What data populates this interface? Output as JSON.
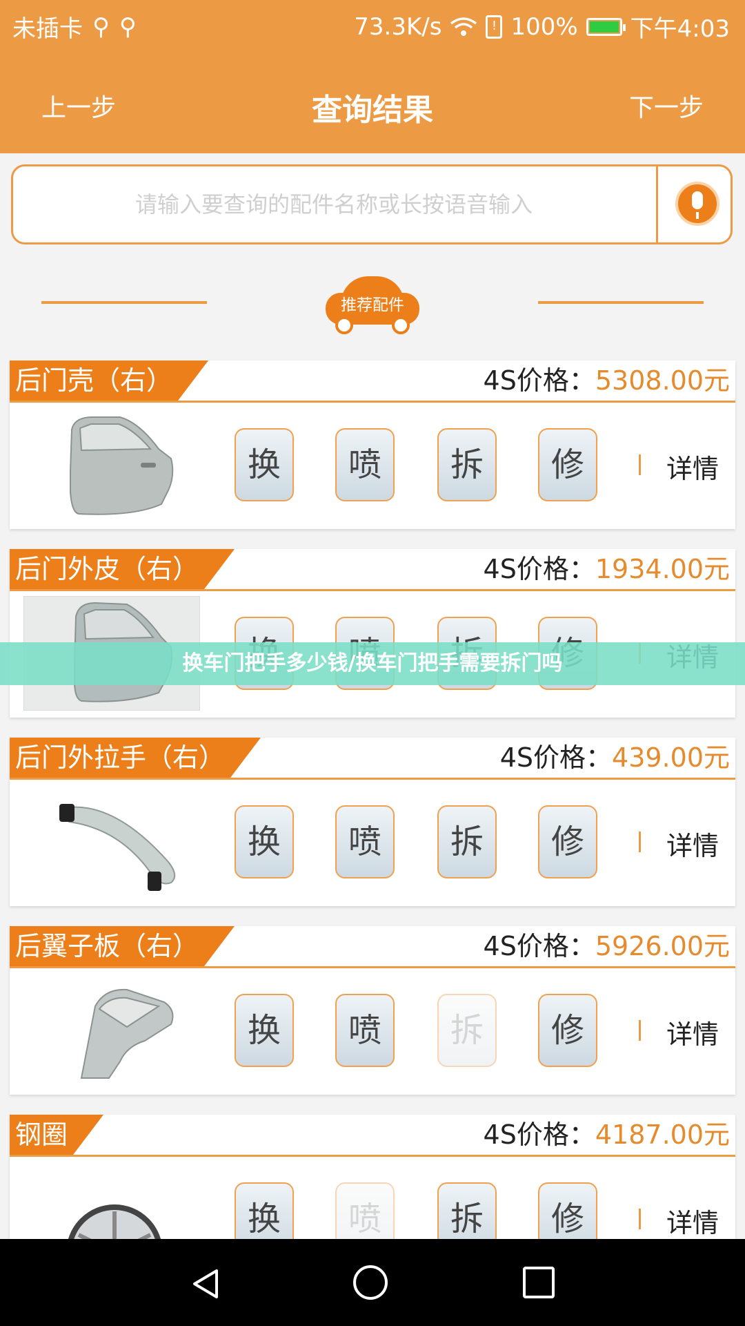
{
  "status_bar": {
    "carrier": "未插卡",
    "usb_icons": [
      "usb-icon",
      "usb-icon"
    ],
    "speed": "73.3K/s",
    "battery": "100%",
    "time": "下午4:03"
  },
  "header": {
    "prev_label": "上一步",
    "title": "查询结果",
    "next_label": "下一步"
  },
  "search": {
    "placeholder": "请输入要查询的配件名称或长按语音输入",
    "value": ""
  },
  "section": {
    "label": "推荐配件"
  },
  "parts": [
    {
      "name": "后门壳（右）",
      "price_label": "4S价格：",
      "price": "5308.00元",
      "image": "rear-door-shell-image",
      "actions": [
        "换",
        "喷",
        "拆",
        "修"
      ],
      "disabled": [
        false,
        false,
        false,
        false
      ],
      "detail": "详情"
    },
    {
      "name": "后门外皮（右）",
      "price_label": "4S价格：",
      "price": "1934.00元",
      "image": "rear-door-skin-image",
      "actions": [
        "换",
        "喷",
        "拆",
        "修"
      ],
      "disabled": [
        false,
        false,
        false,
        false
      ],
      "detail": "详情"
    },
    {
      "name": "后门外拉手（右）",
      "price_label": "4S价格：",
      "price": "439.00元",
      "image": "door-handle-image",
      "actions": [
        "换",
        "喷",
        "拆",
        "修"
      ],
      "disabled": [
        false,
        false,
        false,
        false
      ],
      "detail": "详情"
    },
    {
      "name": "后翼子板（右）",
      "price_label": "4S价格：",
      "price": "5926.00元",
      "image": "rear-fender-image",
      "actions": [
        "换",
        "喷",
        "拆",
        "修"
      ],
      "disabled": [
        false,
        false,
        true,
        false
      ],
      "detail": "详情"
    },
    {
      "name": "钢圈",
      "price_label": "4S价格：",
      "price": "4187.00元",
      "image": "wheel-rim-image",
      "actions": [
        "换",
        "喷",
        "拆",
        "修"
      ],
      "disabled": [
        false,
        true,
        false,
        false
      ],
      "detail": "详情"
    }
  ],
  "banner": {
    "text": "换车门把手多少钱/换车门把手需要拆门吗"
  },
  "colors": {
    "accent": "#ec9a43",
    "tag": "#ec7f1a",
    "price": "#e58b2d",
    "banner": "#7adec6"
  }
}
